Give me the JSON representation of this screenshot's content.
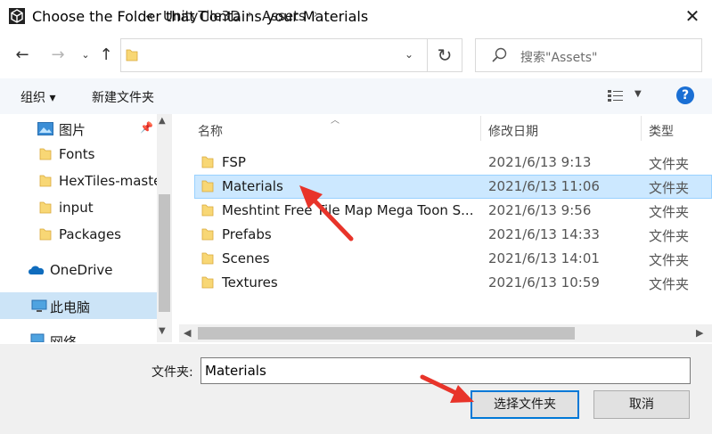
{
  "window": {
    "title": "Choose the Folder that Contains your Materials"
  },
  "address": {
    "segments": [
      "UnityTile3D",
      "Assets"
    ],
    "overflow_symbol": "«"
  },
  "search": {
    "placeholder": "搜索\"Assets\""
  },
  "toolbar": {
    "organize_label": "组织 ▾",
    "new_folder_label": "新建文件夹",
    "help_label": "?"
  },
  "nav": {
    "items": [
      {
        "label": "图片",
        "icon": "pictures-icon",
        "pinned": true
      },
      {
        "label": "Fonts",
        "icon": "folder-icon"
      },
      {
        "label": "HexTiles-maste",
        "icon": "folder-icon"
      },
      {
        "label": "input",
        "icon": "folder-icon"
      },
      {
        "label": "Packages",
        "icon": "folder-icon"
      },
      {
        "label": "OneDrive",
        "icon": "onedrive-icon"
      },
      {
        "label": "此电脑",
        "icon": "pc-icon",
        "selected": true
      },
      {
        "label": "网络",
        "icon": "network-icon"
      }
    ]
  },
  "list": {
    "columns": {
      "name": "名称",
      "date": "修改日期",
      "type": "类型"
    },
    "rows": [
      {
        "name": "FSP",
        "date": "2021/6/13 9:13",
        "type": "文件夹"
      },
      {
        "name": "Materials",
        "date": "2021/6/13 11:06",
        "type": "文件夹",
        "selected": true
      },
      {
        "name": "Meshtint Free Tile Map Mega Toon S...",
        "date": "2021/6/13 9:56",
        "type": "文件夹"
      },
      {
        "name": "Prefabs",
        "date": "2021/6/13 14:33",
        "type": "文件夹"
      },
      {
        "name": "Scenes",
        "date": "2021/6/13 14:01",
        "type": "文件夹"
      },
      {
        "name": "Textures",
        "date": "2021/6/13 10:59",
        "type": "文件夹"
      }
    ]
  },
  "footer": {
    "folder_label": "文件夹:",
    "folder_value": "Materials",
    "select_button": "选择文件夹",
    "cancel_button": "取消"
  },
  "colors": {
    "selection": "#cce8ff",
    "accent": "#0078d7",
    "folder": "#f8d775",
    "annotation_arrow": "#e8342a"
  }
}
